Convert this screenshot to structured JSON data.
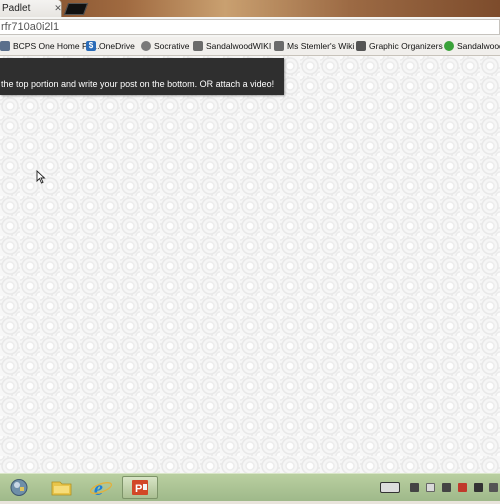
{
  "browser": {
    "active_tab_title": "Padlet",
    "address": "rfr710a0i2l1"
  },
  "bookmarks": [
    {
      "label": "BCPS One Home Pa...",
      "icon": "bcps-icon",
      "color": "#5a6f8c"
    },
    {
      "label": "OneDrive",
      "icon": "onedrive-icon",
      "color": "#2b6cb8"
    },
    {
      "label": "Socrative",
      "icon": "socrative-icon",
      "color": "#7a7a7a"
    },
    {
      "label": "SandalwoodWIKI",
      "icon": "wiki-icon",
      "color": "#6b6b6b"
    },
    {
      "label": "Ms Stemler's Wiki",
      "icon": "wiki-icon",
      "color": "#6b6b6b"
    },
    {
      "label": "Graphic Organizers",
      "icon": "page-icon",
      "color": "#555555"
    },
    {
      "label": "Sandalwood",
      "icon": "green-dot-icon",
      "color": "#3aa23a"
    }
  ],
  "banner": {
    "text": "the top portion and write your post on the bottom. OR attach a video!"
  },
  "taskbar": {
    "apps": [
      "start-orb-icon",
      "file-explorer-icon",
      "internet-explorer-icon",
      "powerpoint-icon"
    ],
    "active_app": "powerpoint-icon"
  },
  "colors": {
    "banner_bg": "#2f2f2f",
    "taskbar": "#a9c293",
    "ie_blue": "#1e7fd6",
    "powerpoint_red": "#d24726"
  }
}
